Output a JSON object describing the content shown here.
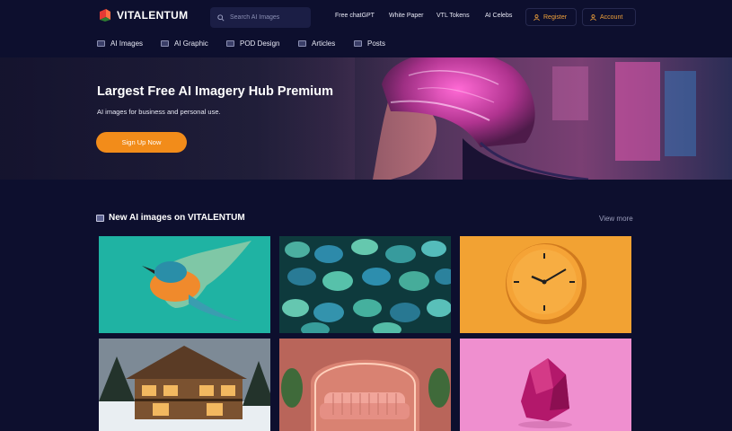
{
  "brand": {
    "name": "VITALENTUM"
  },
  "search": {
    "placeholder": "Search AI Images"
  },
  "top_links": [
    "Free chatGPT",
    "White Paper",
    "VTL Tokens",
    "AI Celebs"
  ],
  "account": {
    "register": "Register",
    "account": "Account"
  },
  "nav": [
    "AI Images",
    "AI Graphic",
    "POD Design",
    "Articles",
    "Posts"
  ],
  "hero": {
    "title": "Largest Free AI Imagery Hub Premium",
    "subtitle": "AI images for business and personal use.",
    "cta": "Sign Up Now"
  },
  "section": {
    "title": "New AI images on VITALENTUM",
    "view_more": "View more"
  },
  "colors": {
    "background": "#0d0f2e",
    "accent": "#f28c1a",
    "account_text": "#f0a13a"
  },
  "icons": [
    "search-icon",
    "user-icon",
    "image-icon"
  ]
}
